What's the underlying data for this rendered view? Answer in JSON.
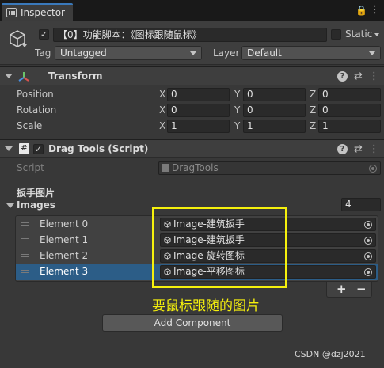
{
  "window": {
    "tab_title": "Inspector",
    "icons": [
      "inspector-icon",
      "lock-icon",
      "menu-icon"
    ]
  },
  "gameobject": {
    "active": true,
    "name": "【0】功能脚本：《图标跟随鼠标》",
    "static_label": "Static",
    "static_checked": false,
    "tag_label": "Tag",
    "tag_value": "Untagged",
    "layer_label": "Layer",
    "layer_value": "Default"
  },
  "transform": {
    "title": "Transform",
    "rows": [
      {
        "label": "Position",
        "x": "0",
        "y": "0",
        "z": "0"
      },
      {
        "label": "Rotation",
        "x": "0",
        "y": "0",
        "z": "0"
      },
      {
        "label": "Scale",
        "x": "1",
        "y": "1",
        "z": "1"
      }
    ],
    "axes": {
      "x": "X",
      "y": "Y",
      "z": "Z"
    }
  },
  "dragtools": {
    "title": "Drag Tools (Script)",
    "enabled": true,
    "script_label": "Script",
    "script_value": "DragTools",
    "header_label": "扳手图片",
    "images_label": "Images",
    "images_count": "4",
    "elements": [
      {
        "label": "Element 0",
        "value": "Image-建筑扳手"
      },
      {
        "label": "Element 1",
        "value": "Image-建筑扳手"
      },
      {
        "label": "Element 2",
        "value": "Image-旋转图标"
      },
      {
        "label": "Element 3",
        "value": "Image-平移图标"
      }
    ],
    "selected_index": 3,
    "plus": "+",
    "minus": "−"
  },
  "add_component": "Add Component",
  "annotation": "要鼠标跟随的图片",
  "watermark": "CSDN @dzj2021",
  "colors": {
    "accent": "#3a79bb",
    "selected_row": "#2c5d87",
    "annotation": "#f5f00d",
    "background": "#383838"
  }
}
